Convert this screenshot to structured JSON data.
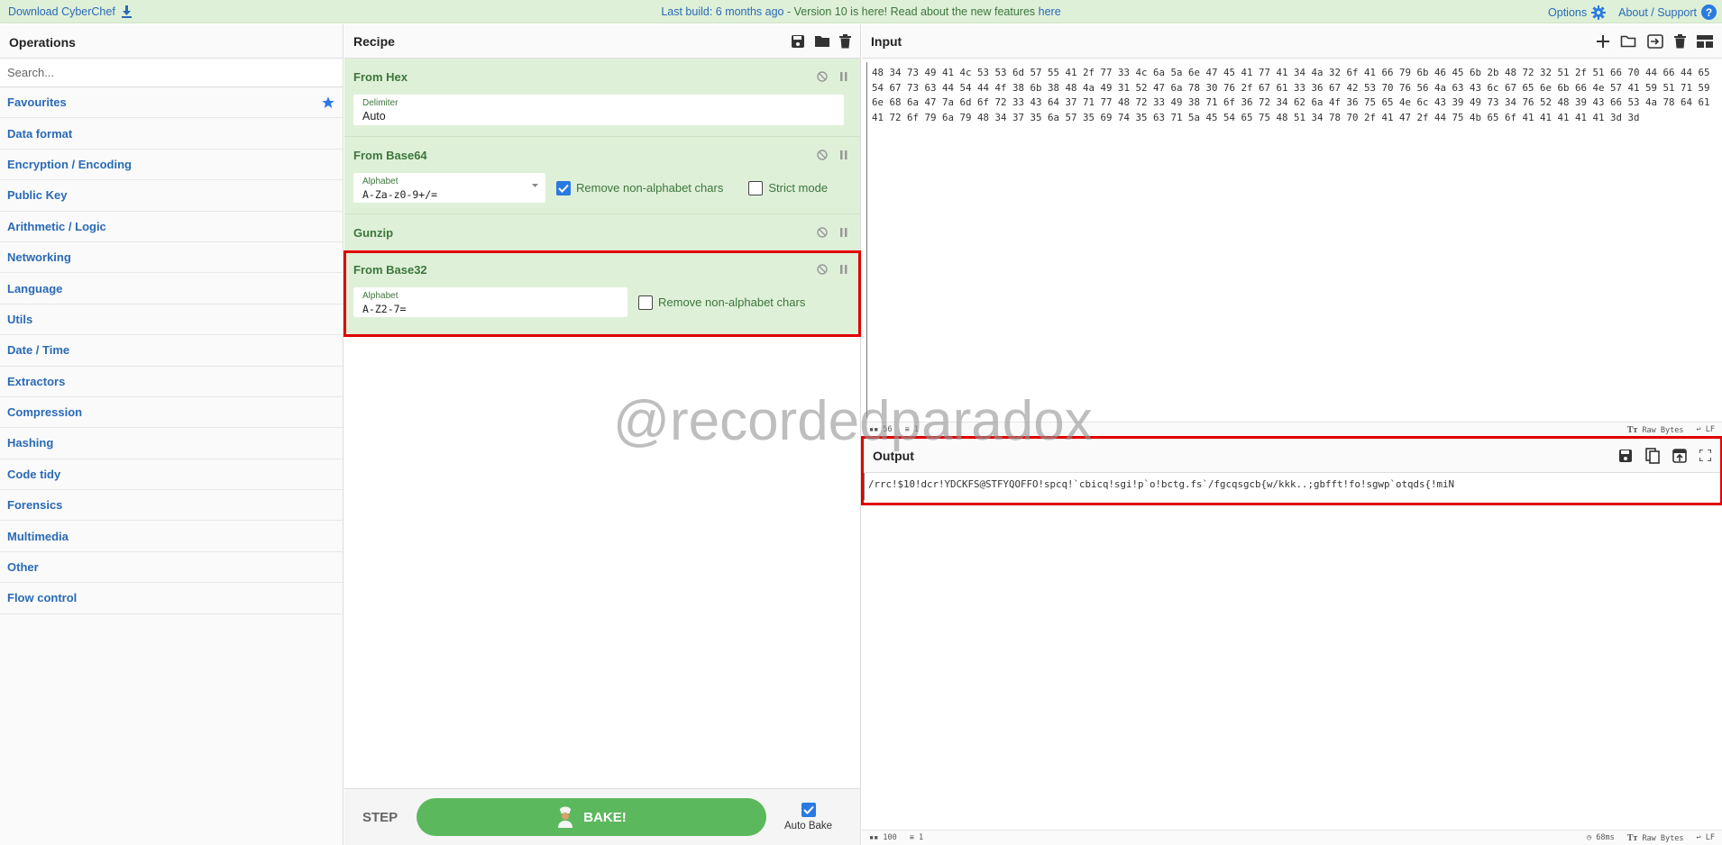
{
  "banner": {
    "download_label": "Download CyberChef",
    "build_text": "Last build: 6 months ago",
    "separator": " - ",
    "version_text": "Version 10 is here! Read about the new features ",
    "here_link": "here",
    "options_label": "Options",
    "about_label": "About / Support"
  },
  "operations": {
    "title": "Operations",
    "search_placeholder": "Search...",
    "items": [
      {
        "label": "Favourites"
      },
      {
        "label": "Data format"
      },
      {
        "label": "Encryption / Encoding"
      },
      {
        "label": "Public Key"
      },
      {
        "label": "Arithmetic / Logic"
      },
      {
        "label": "Networking"
      },
      {
        "label": "Language"
      },
      {
        "label": "Utils"
      },
      {
        "label": "Date / Time"
      },
      {
        "label": "Extractors"
      },
      {
        "label": "Compression"
      },
      {
        "label": "Hashing"
      },
      {
        "label": "Code tidy"
      },
      {
        "label": "Forensics"
      },
      {
        "label": "Multimedia"
      },
      {
        "label": "Other"
      },
      {
        "label": "Flow control"
      }
    ]
  },
  "recipe": {
    "title": "Recipe",
    "ops": [
      {
        "name": "From Hex",
        "field_label": "Delimiter",
        "field_value": "Auto"
      },
      {
        "name": "From Base64",
        "field_label": "Alphabet",
        "field_value": "A-Za-z0-9+/=",
        "check1_label": "Remove non-alphabet chars",
        "check1_on": true,
        "check2_label": "Strict mode",
        "check2_on": false
      },
      {
        "name": "Gunzip"
      },
      {
        "name": "From Base32",
        "field_label": "Alphabet",
        "field_value": "A-Z2-7=",
        "check1_label": "Remove non-alphabet chars",
        "check1_on": false
      }
    ],
    "step_label": "STEP",
    "bake_label": "BAKE!",
    "autobake_label": "Auto Bake",
    "autobake_on": true
  },
  "input": {
    "title": "Input",
    "text": "48 34 73 49 41 4c 53 53 6d 57 55 41 2f 77 33 4c 6a 5a 6e 47 45 41 77 41 34 4a 32 6f 41 66 79 6b 46 45 6b 2b 48 72 32 51 2f 51 66 70 44 66 44 65 54 67 73 63 44 54 44 4f 38 6b 38 48 4a 49 31 52 47 6a 78 30 76 2f 67 61 33 36 67 42 53 70 76 56 4a 63 43 6c 67 65 6e 6b 66 4e 57 41 59 51 71 59 6e 68 6a 47 7a 6d 6f 72 33 43 64 37 71 77 48 72 33 49 38 71 6f 36 72 34 62 6a 4f 36 75 65 4e 6c 43 39 49 73 34 76 52 48 39 43 66 53 4a 78 64 61 41 72 6f 79 6a 79 48 34 37 35 6a 57 35 69 74 35 63 71 5a 45 54 65 75 48 51 34 78 70 2f 41 47 2f 44 75 4b 65 6f 41 41 41 41 41 3d 3d",
    "status_length": "56",
    "status_lines": "1",
    "status_format": "Raw Bytes",
    "status_eol": "LF"
  },
  "output": {
    "title": "Output",
    "text": "/rrc!$10!dcr!YDCKFS@STFYQOFFO!spcq!`cbicq!sgi!p`o!bctg.fs`/fgcqsgcb{w/kkk..;gbfft!fo!sgwp`otqds{!miN",
    "status_length": "100",
    "status_lines": "1",
    "status_time": "68ms",
    "status_format": "Raw Bytes",
    "status_eol": "LF"
  },
  "watermark": "@recordedparadox",
  "colors": {
    "accent_blue": "#2a6ab6",
    "recipe_green_bg": "#dff0d8",
    "recipe_green_text": "#3c763d",
    "bake_green": "#5cb85c",
    "highlight_red": "#e00000"
  }
}
